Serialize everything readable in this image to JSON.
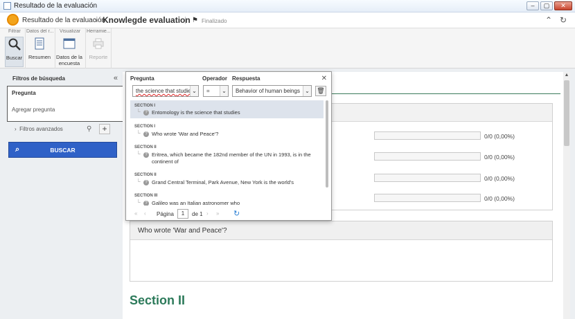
{
  "window": {
    "title": "Resultado de la evaluación",
    "buttons": [
      "–",
      "▢",
      "✕"
    ]
  },
  "header": {
    "breadcrumb_parent": "Resultado de la evaluación",
    "separator": "›",
    "title": "Knowlegde evaluation",
    "status": "Finalizado"
  },
  "toolbar": {
    "groups": [
      "Filtrar",
      "Datos del r...",
      "Visualizar",
      "Herramie..."
    ],
    "buttons": {
      "buscar": "Buscar",
      "resumen": "Resumen",
      "datos_encuesta_line1": "Datos de la",
      "datos_encuesta_line2": "encuesta",
      "reporte": "Reporte"
    }
  },
  "filters": {
    "title": "Filtros de búsqueda",
    "pregunta_label": "Pregunta",
    "add_question": "Agregar pregunta",
    "advanced": "Filtros avanzados",
    "search_button": "BUSCAR"
  },
  "popup": {
    "col_pregunta": "Pregunta",
    "col_operador": "Operador",
    "col_respuesta": "Respuesta",
    "pregunta_value_prefix": "the science that ",
    "pregunta_value_typo": "studies",
    "operador_value": "=",
    "respuesta_value": "Behavior of human beings",
    "items": [
      {
        "section": "SECTION I",
        "text": "Entomology is the science that studies",
        "selected": true
      },
      {
        "section": "SECTION I",
        "text": "Who wrote 'War and Peace'?",
        "selected": false
      },
      {
        "section": "SECTION II",
        "text": "Eritrea, which became the 182nd member of the UN in 1993, is in the continent of",
        "selected": false
      },
      {
        "section": "SECTION II",
        "text": "Grand Central Terminal, Park Avenue, New York is the world's",
        "selected": false
      },
      {
        "section": "SECTION III",
        "text": "Galileo was an Italian astronomer who",
        "selected": false
      }
    ],
    "pager": {
      "label": "Página",
      "page": "1",
      "of": "de 1"
    }
  },
  "results": {
    "rows": [
      {
        "value": "0/0 (0,00%)",
        "fraction": 0
      },
      {
        "value": "0/0 (0,00%)",
        "fraction": 0
      },
      {
        "value": "0/0 (0,00%)",
        "fraction": 0
      },
      {
        "value": "0/0 (0,00%)",
        "fraction": 0
      }
    ],
    "question2": "Who wrote 'War and Peace'?",
    "section_heading": "Section II"
  },
  "colors": {
    "accent_blue": "#2f61c7",
    "section_green": "#2c7a5a"
  }
}
